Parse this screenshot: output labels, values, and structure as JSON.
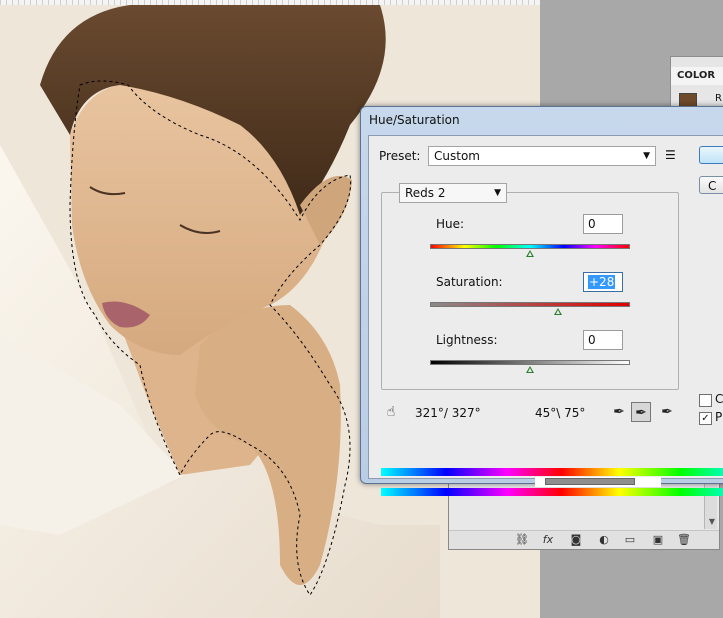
{
  "workspace": {
    "color_panel": {
      "tab": "COLOR",
      "channel_label": "R",
      "swatch_color": "#6e4a2a"
    }
  },
  "dialog": {
    "title": "Hue/Saturation",
    "preset_label": "Preset:",
    "preset_value": "Custom",
    "preset_menu_icon": "list-menu-icon",
    "range_value": "Reds 2",
    "hue_label": "Hue:",
    "hue_value": "0",
    "saturation_label": "Saturation:",
    "saturation_value": "+28",
    "lightness_label": "Lightness:",
    "lightness_value": "0",
    "angles_left": "321°/ 327°",
    "angles_right": "45°\\ 75°",
    "ok_label": "",
    "cancel_label": "C",
    "colorize_label": "Co",
    "preview_label": "Pr",
    "preview_checked": true
  },
  "layers": {
    "footer_icons": [
      "link-icon",
      "fx-icon",
      "mask-icon",
      "adjustment-icon",
      "folder-icon",
      "new-layer-icon",
      "trash-icon"
    ]
  }
}
